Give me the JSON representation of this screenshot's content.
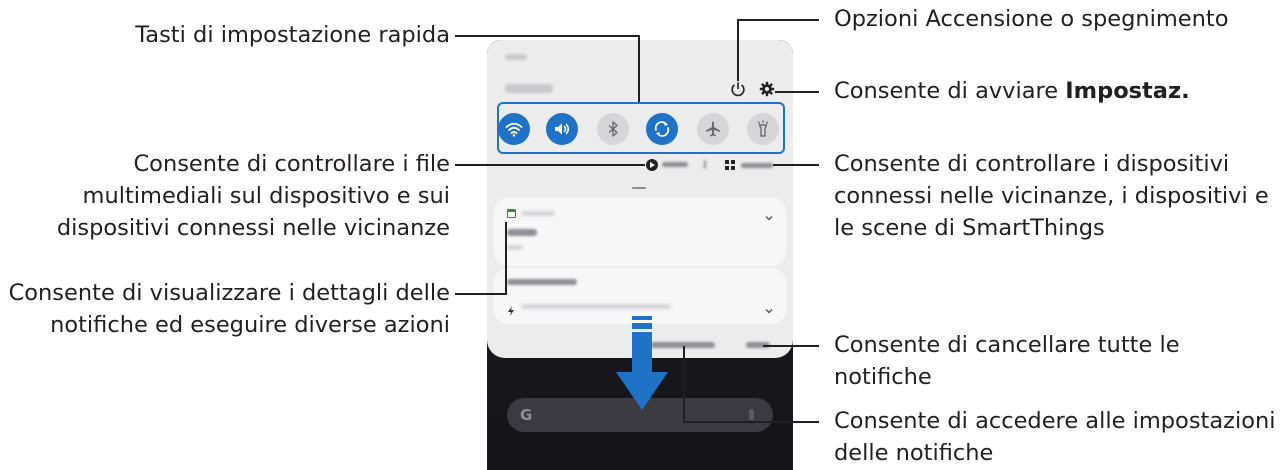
{
  "callouts": {
    "quick_settings": "Tasti di impostazione rapida",
    "media": [
      "Consente di controllare i file",
      "multimediali sul dispositivo e sui",
      "dispositivi connessi nelle vicinanze"
    ],
    "notifications": [
      "Consente di visualizzare i dettagli delle",
      "notifiche ed eseguire diverse azioni"
    ],
    "power": "Opzioni Accensione o spegnimento",
    "settings_prefix": "Consente di avviare ",
    "settings_bold": "Impostaz.",
    "devices": [
      "Consente di controllare i dispositivi",
      "connessi nelle vicinanze, i dispositivi e",
      "le scene di SmartThings"
    ],
    "clear": [
      "Consente di cancellare tutte le",
      "notifiche"
    ],
    "notif_settings": [
      "Consente di accedere alle impostazioni",
      "delle notifiche"
    ]
  },
  "phone": {
    "quick_setting_buttons": [
      {
        "icon": "wifi-icon",
        "state": "on"
      },
      {
        "icon": "sound-icon",
        "state": "on"
      },
      {
        "icon": "bluetooth-icon",
        "state": "off"
      },
      {
        "icon": "auto-rotate-icon",
        "state": "on"
      },
      {
        "icon": "airplane-icon",
        "state": "off"
      },
      {
        "icon": "flashlight-icon",
        "state": "off"
      }
    ],
    "search_letter": "G"
  },
  "colors": {
    "accent": "#1f72c6",
    "text": "#231f20",
    "panel": "#ececed"
  }
}
